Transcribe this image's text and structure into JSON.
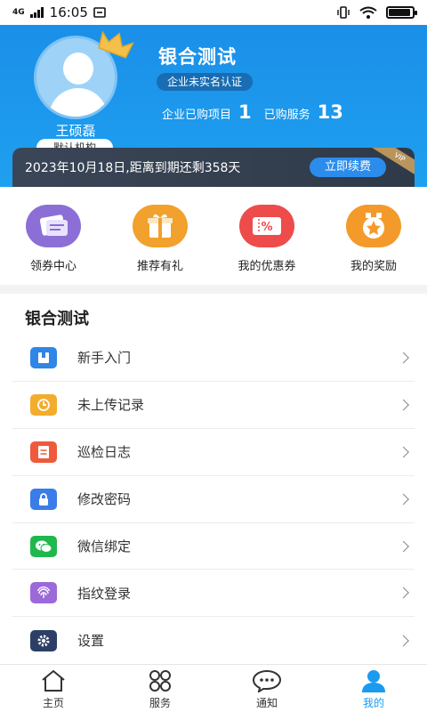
{
  "status_bar": {
    "network": "4G",
    "time": "16:05"
  },
  "profile": {
    "user_name": "王硕磊",
    "org_badge": "默认机构",
    "company": "银合测试",
    "cert_status": "企业未实名认证",
    "purchased_items_label": "企业已购项目",
    "purchased_items_count": "1",
    "purchased_services_label": "已购服务",
    "purchased_services_count": "13"
  },
  "vip": {
    "expiry_text": "2023年10月18日,距离到期还剩358天",
    "renew_label": "立即续费",
    "ribbon": "VIP"
  },
  "quick_actions": [
    {
      "label": "领券中心",
      "icon": "coupon-center-icon",
      "color": "#8b6fd6"
    },
    {
      "label": "推荐有礼",
      "icon": "gift-icon",
      "color": "#f1a12c"
    },
    {
      "label": "我的优惠券",
      "icon": "discount-coupon-icon",
      "color": "#ee4b4b"
    },
    {
      "label": "我的奖励",
      "icon": "reward-icon",
      "color": "#f39a2b"
    }
  ],
  "menu": {
    "title": "银合测试",
    "items": [
      {
        "label": "新手入门",
        "icon": "book-icon",
        "color": "#2f86e6"
      },
      {
        "label": "未上传记录",
        "icon": "clock-icon",
        "color": "#f2ad2c"
      },
      {
        "label": "巡检日志",
        "icon": "log-icon",
        "color": "#ef5a3b"
      },
      {
        "label": "修改密码",
        "icon": "lock-icon",
        "color": "#3b7de8"
      },
      {
        "label": "微信绑定",
        "icon": "wechat-icon",
        "color": "#1fb84d"
      },
      {
        "label": "指纹登录",
        "icon": "fingerprint-icon",
        "color": "#9b6ad8"
      },
      {
        "label": "设置",
        "icon": "gear-icon",
        "color": "#2d3f66"
      }
    ]
  },
  "bottom_nav": [
    {
      "label": "主页",
      "icon": "home-icon"
    },
    {
      "label": "服务",
      "icon": "grid-icon"
    },
    {
      "label": "通知",
      "icon": "chat-icon"
    },
    {
      "label": "我的",
      "icon": "user-icon",
      "active": true
    }
  ],
  "colors": {
    "header": "#1b8fe8",
    "accent": "#1a9bf0",
    "vip_bar": "#3a4657"
  }
}
